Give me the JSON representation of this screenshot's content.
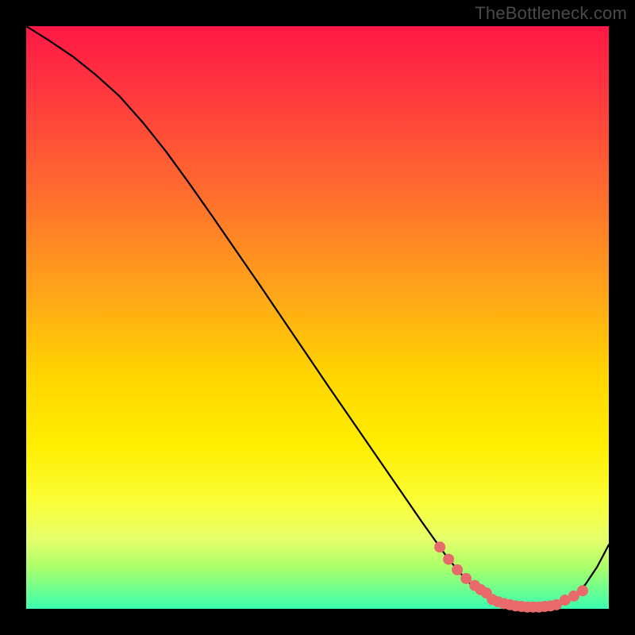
{
  "watermark": "TheBottleneck.com",
  "chart_data": {
    "type": "line",
    "title": "",
    "xlabel": "",
    "ylabel": "",
    "xlim": [
      0,
      100
    ],
    "ylim": [
      0,
      100
    ],
    "series": [
      {
        "name": "curve",
        "x": [
          0,
          4,
          8,
          12,
          16,
          20,
          24,
          28,
          32,
          36,
          40,
          44,
          48,
          52,
          56,
          60,
          64,
          68,
          72,
          74,
          76,
          78,
          80,
          82,
          84,
          86,
          88,
          90,
          92,
          94,
          96,
          98,
          100
        ],
        "y": [
          100,
          97.5,
          94.8,
          91.6,
          88.0,
          83.5,
          78.5,
          73.0,
          67.3,
          61.5,
          55.7,
          49.8,
          43.9,
          38.0,
          32.2,
          26.4,
          20.6,
          14.8,
          9.2,
          6.7,
          4.5,
          2.8,
          1.6,
          0.9,
          0.5,
          0.3,
          0.3,
          0.5,
          1.0,
          2.2,
          4.2,
          7.2,
          11.0
        ]
      }
    ],
    "markers": {
      "name": "highlight-dots",
      "color": "#e86a6a",
      "x": [
        71.0,
        72.5,
        74.0,
        75.5,
        77.0,
        78.0,
        79.0,
        80.0,
        81.0,
        82.0,
        83.0,
        84.0,
        85.0,
        86.0,
        87.0,
        88.0,
        89.0,
        90.0,
        91.0,
        92.5,
        94.0,
        95.5
      ],
      "y": [
        10.6,
        8.5,
        6.7,
        5.2,
        4.0,
        3.3,
        2.7,
        1.6,
        1.2,
        0.9,
        0.7,
        0.5,
        0.4,
        0.3,
        0.3,
        0.3,
        0.4,
        0.5,
        0.7,
        1.5,
        2.2,
        3.1
      ]
    },
    "gradient_stops": [
      {
        "pos": 0.0,
        "color": "#ff1846"
      },
      {
        "pos": 0.12,
        "color": "#ff3a3e"
      },
      {
        "pos": 0.28,
        "color": "#ff6a2e"
      },
      {
        "pos": 0.45,
        "color": "#ffa31a"
      },
      {
        "pos": 0.6,
        "color": "#ffd500"
      },
      {
        "pos": 0.72,
        "color": "#ffee00"
      },
      {
        "pos": 0.82,
        "color": "#f9ff3a"
      },
      {
        "pos": 0.88,
        "color": "#e6ff6a"
      },
      {
        "pos": 0.93,
        "color": "#a8ff6a"
      },
      {
        "pos": 1.0,
        "color": "#3affb0"
      }
    ]
  }
}
